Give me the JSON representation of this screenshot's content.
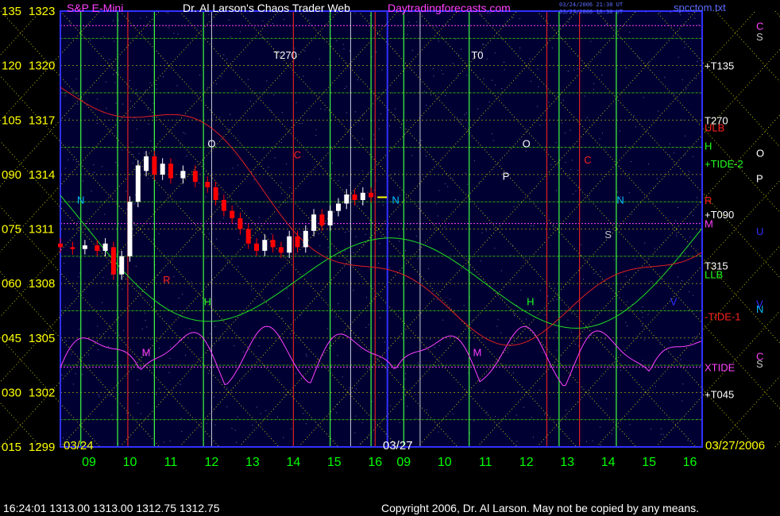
{
  "header": {
    "title_prefix": "S&P E-Mini",
    "author": "Dr. Al Larson's Chaos Trader Web",
    "site": "Daytradingforecasts.com",
    "timestamp_1": "03/24/2006 21:30 UT",
    "timestamp_2": "03/27/2006 16:30 UT",
    "file": "spcctom.txt"
  },
  "footer": {
    "quote": "16:24:01  1313.00 1313.00 1312.75 1312.75",
    "copyright": "Copyright 2006, Dr. Al Larson. May not be copied by any means."
  },
  "colors": {
    "background": "#000033",
    "price_up": "#ffffff",
    "price_down": "#ff0000",
    "grid_green": "#00c800",
    "grid_yellow": "#e8e800",
    "magenta": "#ff40ff",
    "red_line": "#e02020",
    "axis_text": "#ffff00",
    "time_labels": "#00ff00"
  },
  "chart_data": {
    "type": "line",
    "title": "S&P E-Mini",
    "y_axis_left": {
      "labels": [
        "135",
        "120",
        "105",
        "090",
        "075",
        "060",
        "045",
        "030",
        "015"
      ],
      "prices": [
        "1323",
        "1320",
        "1317",
        "1314",
        "1311",
        "1308",
        "1305",
        "1302",
        "1299"
      ],
      "ylim": [
        1299,
        1323
      ]
    },
    "x_axis": {
      "ticks_day1": [
        "09",
        "10",
        "11",
        "12",
        "13",
        "14",
        "15",
        "16"
      ],
      "ticks_day2": [
        "09",
        "10",
        "11",
        "12",
        "13",
        "14",
        "15",
        "16"
      ],
      "dates": [
        "03/24",
        "03/27",
        "03/27/2006"
      ]
    },
    "price_series": [
      {
        "t": 8.3,
        "o": 1310.2,
        "c": 1310.0
      },
      {
        "t": 8.6,
        "o": 1310.0,
        "c": 1309.9
      },
      {
        "t": 8.9,
        "o": 1309.9,
        "c": 1310.1
      },
      {
        "t": 9.2,
        "o": 1310.1,
        "c": 1309.8
      },
      {
        "t": 9.4,
        "o": 1309.8,
        "c": 1310.2
      },
      {
        "t": 9.6,
        "o": 1310.0,
        "c": 1308.5
      },
      {
        "t": 9.8,
        "o": 1308.5,
        "c": 1309.5
      },
      {
        "t": 10.0,
        "o": 1309.5,
        "c": 1312.5
      },
      {
        "t": 10.2,
        "o": 1312.5,
        "c": 1314.5
      },
      {
        "t": 10.4,
        "o": 1314.2,
        "c": 1315.0
      },
      {
        "t": 10.6,
        "o": 1315.0,
        "c": 1314.0
      },
      {
        "t": 10.8,
        "o": 1314.0,
        "c": 1314.6
      },
      {
        "t": 11.0,
        "o": 1314.6,
        "c": 1313.8
      },
      {
        "t": 11.3,
        "o": 1313.8,
        "c": 1314.2
      },
      {
        "t": 11.6,
        "o": 1314.2,
        "c": 1313.6
      },
      {
        "t": 11.9,
        "o": 1313.6,
        "c": 1313.3
      },
      {
        "t": 12.1,
        "o": 1313.3,
        "c": 1312.6
      },
      {
        "t": 12.3,
        "o": 1312.6,
        "c": 1312.0
      },
      {
        "t": 12.5,
        "o": 1312.0,
        "c": 1311.6
      },
      {
        "t": 12.7,
        "o": 1311.6,
        "c": 1311.0
      },
      {
        "t": 12.9,
        "o": 1311.0,
        "c": 1310.2
      },
      {
        "t": 13.1,
        "o": 1310.2,
        "c": 1309.8
      },
      {
        "t": 13.3,
        "o": 1309.8,
        "c": 1310.4
      },
      {
        "t": 13.5,
        "o": 1310.4,
        "c": 1310.0
      },
      {
        "t": 13.7,
        "o": 1310.0,
        "c": 1309.7
      },
      {
        "t": 13.9,
        "o": 1309.7,
        "c": 1310.6
      },
      {
        "t": 14.1,
        "o": 1310.6,
        "c": 1310.0
      },
      {
        "t": 14.3,
        "o": 1310.0,
        "c": 1310.9
      },
      {
        "t": 14.5,
        "o": 1310.9,
        "c": 1311.8
      },
      {
        "t": 14.7,
        "o": 1311.8,
        "c": 1311.2
      },
      {
        "t": 14.9,
        "o": 1311.2,
        "c": 1312.0
      },
      {
        "t": 15.1,
        "o": 1312.0,
        "c": 1312.4
      },
      {
        "t": 15.3,
        "o": 1312.4,
        "c": 1312.9
      },
      {
        "t": 15.5,
        "o": 1312.9,
        "c": 1312.6
      },
      {
        "t": 15.7,
        "o": 1312.6,
        "c": 1313.0
      },
      {
        "t": 15.9,
        "o": 1313.0,
        "c": 1312.75
      }
    ],
    "level_labels": {
      "right": [
        {
          "text": "+T135",
          "price": 1320.0,
          "color": "#ffffff"
        },
        {
          "text": "T270",
          "price": 1317.0,
          "color": "#ffffff"
        },
        {
          "text": "ULB",
          "price": 1316.6,
          "color": "#ff2020"
        },
        {
          "text": "H",
          "price": 1315.6,
          "color": "#20ff20"
        },
        {
          "text": "+TIDE-2",
          "price": 1314.6,
          "color": "#20ff20"
        },
        {
          "text": "R",
          "price": 1312.6,
          "color": "#ff2020"
        },
        {
          "text": "+T090",
          "price": 1311.8,
          "color": "#ffffff"
        },
        {
          "text": "M",
          "price": 1311.3,
          "color": "#ff40ff"
        },
        {
          "text": "T315",
          "price": 1309.0,
          "color": "#ffffff"
        },
        {
          "text": "LLB",
          "price": 1308.5,
          "color": "#20ff20"
        },
        {
          "text": "-TIDE-1",
          "price": 1306.2,
          "color": "#ff2020"
        },
        {
          "text": "XTIDE",
          "price": 1303.4,
          "color": "#ff40ff"
        },
        {
          "text": "+T045",
          "price": 1301.9,
          "color": "#ffffff"
        }
      ],
      "far_right": [
        {
          "text": "C",
          "price": 1322.2,
          "color": "#ff40ff"
        },
        {
          "text": "S",
          "price": 1321.6,
          "color": "#c0c0c0"
        },
        {
          "text": "O",
          "price": 1315.2,
          "color": "#ffffff"
        },
        {
          "text": "P",
          "price": 1313.8,
          "color": "#ffffff"
        },
        {
          "text": "U",
          "price": 1310.9,
          "color": "#3030ff"
        },
        {
          "text": "N",
          "price": 1306.6,
          "color": "#00c0ff"
        },
        {
          "text": "C",
          "price": 1304.0,
          "color": "#ff40ff"
        },
        {
          "text": "S",
          "price": 1303.6,
          "color": "#c0c0c0"
        },
        {
          "text": "V",
          "price": 1306.9,
          "color": "#3030ff"
        }
      ],
      "top": [
        {
          "text": "T270",
          "t": 13.8
        },
        {
          "text": "T0",
          "t": 18.5
        }
      ]
    },
    "vertical_lines_green": [
      8.8,
      9.7,
      10.6,
      11.8,
      14.9,
      15.9,
      16.7,
      18.3,
      20.5,
      21.9
    ],
    "vertical_lines_red": [
      9.95,
      14.0,
      16.0,
      20.2,
      21.0
    ],
    "vertical_lines_white": [
      12.0,
      15.4,
      17.1
    ],
    "marks": [
      {
        "text": "N",
        "t": 8.8,
        "price": 1312.4,
        "color": "#00c0ff"
      },
      {
        "text": "O",
        "t": 12.0,
        "price": 1315.5,
        "color": "#ffffff"
      },
      {
        "text": "R",
        "t": 10.9,
        "price": 1308.0,
        "color": "#ff2020"
      },
      {
        "text": "H",
        "t": 11.9,
        "price": 1306.8,
        "color": "#20ff20"
      },
      {
        "text": "M",
        "t": 10.4,
        "price": 1304.0,
        "color": "#ff40ff"
      },
      {
        "text": "N",
        "t": 16.5,
        "price": 1312.4,
        "color": "#00c0ff"
      },
      {
        "text": "O",
        "t": 19.7,
        "price": 1315.5,
        "color": "#ffffff"
      },
      {
        "text": "P",
        "t": 19.2,
        "price": 1313.7,
        "color": "#ffffff"
      },
      {
        "text": "M",
        "t": 18.5,
        "price": 1304.0,
        "color": "#ff40ff"
      },
      {
        "text": "H",
        "t": 19.8,
        "price": 1306.8,
        "color": "#20ff20"
      },
      {
        "text": "N",
        "t": 22.0,
        "price": 1312.4,
        "color": "#00c0ff"
      },
      {
        "text": "S",
        "t": 21.7,
        "price": 1310.5,
        "color": "#c0c0c0"
      },
      {
        "text": "C",
        "t": 21.2,
        "price": 1314.6,
        "color": "#ff2020"
      },
      {
        "text": "C",
        "t": 14.1,
        "price": 1314.9,
        "color": "#ff2020"
      },
      {
        "text": "V",
        "t": 23.3,
        "price": 1306.8,
        "color": "#3030ff"
      }
    ]
  }
}
